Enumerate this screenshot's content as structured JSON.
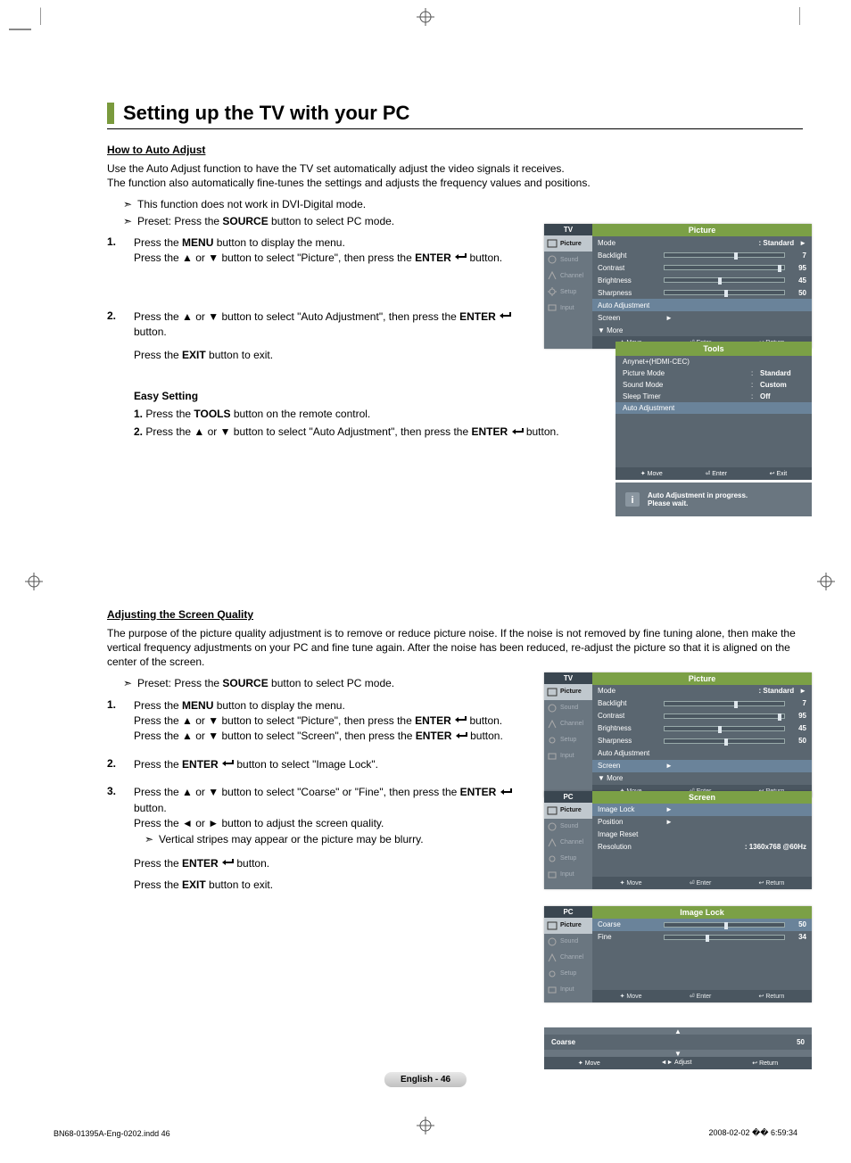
{
  "title": "Setting up the TV with your PC",
  "section1": {
    "heading": "How to Auto Adjust",
    "intro1": "Use the Auto Adjust function to have the TV set automatically adjust the video signals it receives.",
    "intro2": "The function also automatically fine-tunes the settings and adjusts the frequency values and positions.",
    "arrow1": "This function does not work in DVI-Digital mode.",
    "arrow2_pre": "Preset: Press the ",
    "arrow2_b": "SOURCE",
    "arrow2_post": " button to select PC mode.",
    "step1_a": "Press the ",
    "step1_b": "MENU",
    "step1_c": " button to display the menu.",
    "step1_d": "Press the ▲ or ▼ button to select \"Picture\", then press the ",
    "step1_e": "ENTER",
    "step1_f": " button.",
    "step2_a": "Press the ▲ or ▼ button to select \"Auto Adjustment\", then press the ",
    "step2_b": "ENTER",
    "step2_c": " button.",
    "step2_d": "Press the ",
    "step2_e": "EXIT",
    "step2_f": " button to exit.",
    "easy_head": "Easy Setting",
    "easy1_a": "1.",
    "easy1_b": " Press the ",
    "easy1_c": "TOOLS",
    "easy1_d": " button on the remote control.",
    "easy2_a": "2.",
    "easy2_b": " Press the ▲ or ▼ button to select \"Auto Adjustment\", then press the ",
    "easy2_c": "ENTER",
    "easy2_d": " button."
  },
  "osd1": {
    "badge": "TV",
    "header": "Picture",
    "side": [
      "Picture",
      "Sound",
      "Channel",
      "Setup",
      "Input"
    ],
    "rows": [
      {
        "lbl": "Mode",
        "val": ": Standard",
        "type": "text",
        "arrow": true
      },
      {
        "lbl": "Backlight",
        "val": "7",
        "type": "bar",
        "fill": 58
      },
      {
        "lbl": "Contrast",
        "val": "95",
        "type": "bar",
        "fill": 95
      },
      {
        "lbl": "Brightness",
        "val": "45",
        "type": "bar",
        "fill": 45
      },
      {
        "lbl": "Sharpness",
        "val": "50",
        "type": "bar",
        "fill": 50
      },
      {
        "lbl": "Auto Adjustment",
        "type": "sel"
      },
      {
        "lbl": "Screen",
        "arrow": true,
        "type": "text"
      },
      {
        "lbl": "▼ More",
        "type": "text"
      }
    ],
    "footer": [
      "✦ Move",
      "⏎ Enter",
      "↩ Return"
    ]
  },
  "tools": {
    "header": "Tools",
    "rows": [
      {
        "lbl": "Anynet+(HDMI-CEC)",
        "val": ""
      },
      {
        "lbl": "Picture Mode",
        "sep": ":",
        "val": "Standard"
      },
      {
        "lbl": "Sound Mode",
        "sep": ":",
        "val": "Custom"
      },
      {
        "lbl": "Sleep Timer",
        "sep": ":",
        "val": "Off"
      },
      {
        "lbl": "Auto Adjustment",
        "sel": true
      }
    ],
    "footer": [
      "✦ Move",
      "⏎ Enter",
      "↩ Exit"
    ]
  },
  "note": {
    "line1": "Auto Adjustment in progress.",
    "line2": "Please wait."
  },
  "section2": {
    "heading": "Adjusting the Screen Quality",
    "intro": "The purpose of the picture quality adjustment is to remove or reduce picture noise. If the noise is not removed by fine tuning alone, then make the vertical frequency adjustments on your PC and fine tune again. After the noise has been reduced, re-adjust the picture so that it is aligned on the center of the screen.",
    "arrow_pre": "Preset: Press the ",
    "arrow_b": "SOURCE",
    "arrow_post": " button to select PC mode.",
    "step1_a": "Press the ",
    "step1_b": "MENU",
    "step1_c": " button to display the menu.",
    "step1_d": "Press the ▲ or ▼ button to select \"Picture\", then press the ",
    "step1_e": "ENTER",
    "step1_f": " button.",
    "step1_g": "Press the ▲ or ▼ button to select \"Screen\", then press the ",
    "step1_h": "ENTER",
    "step1_i": " button.",
    "step2_a": "Press the ",
    "step2_b": "ENTER",
    "step2_c": " button to select \"Image Lock\".",
    "step3_a": "Press the ▲ or ▼ button to select \"Coarse\" or \"Fine\", then press the ",
    "step3_b": "ENTER",
    "step3_c": " button.",
    "step3_d": "Press the ◄ or ► button to adjust the screen quality.",
    "step3_note": "Vertical stripes may appear or the picture may be blurry.",
    "step3_e": "Press the ",
    "step3_f": "ENTER",
    "step3_g": " button.",
    "step3_h": "Press the ",
    "step3_i": "EXIT",
    "step3_j": " button to exit."
  },
  "osd2": {
    "badge": "TV",
    "header": "Picture",
    "rows": [
      {
        "lbl": "Mode",
        "val": ": Standard",
        "type": "text",
        "arrow": true
      },
      {
        "lbl": "Backlight",
        "val": "7",
        "type": "bar",
        "fill": 58
      },
      {
        "lbl": "Contrast",
        "val": "95",
        "type": "bar",
        "fill": 95
      },
      {
        "lbl": "Brightness",
        "val": "45",
        "type": "bar",
        "fill": 45
      },
      {
        "lbl": "Sharpness",
        "val": "50",
        "type": "bar",
        "fill": 50
      },
      {
        "lbl": "Auto Adjustment",
        "type": "text"
      },
      {
        "lbl": "Screen",
        "type": "sel",
        "arrow": true
      },
      {
        "lbl": "▼ More",
        "type": "text"
      }
    ],
    "footer": [
      "✦ Move",
      "⏎ Enter",
      "↩ Return"
    ]
  },
  "osd3": {
    "badge": "PC",
    "header": "Screen",
    "rows": [
      {
        "lbl": "Image Lock",
        "type": "sel",
        "arrow": true
      },
      {
        "lbl": "Position",
        "type": "text",
        "arrow": true
      },
      {
        "lbl": "Image Reset",
        "type": "text"
      },
      {
        "lbl": "Resolution",
        "val": ": 1360x768 @60Hz",
        "type": "text"
      }
    ],
    "footer": [
      "✦ Move",
      "⏎ Enter",
      "↩ Return"
    ]
  },
  "osd4": {
    "badge": "PC",
    "header": "Image Lock",
    "rows": [
      {
        "lbl": "Coarse",
        "val": "50",
        "type": "bar",
        "fill": 50,
        "sel": true
      },
      {
        "lbl": "Fine",
        "val": "34",
        "type": "bar",
        "fill": 34
      }
    ],
    "footer": [
      "✦ Move",
      "⏎ Enter",
      "↩ Return"
    ]
  },
  "single": {
    "lbl": "Coarse",
    "val": "50",
    "fill": 50,
    "footer": [
      "✦ Move",
      "◄► Adjust",
      "↩ Return"
    ]
  },
  "pagenum": "English - 46",
  "foot_left": "BN68-01395A-Eng-0202.indd   46",
  "foot_right": "2008-02-02   �� 6:59:34"
}
